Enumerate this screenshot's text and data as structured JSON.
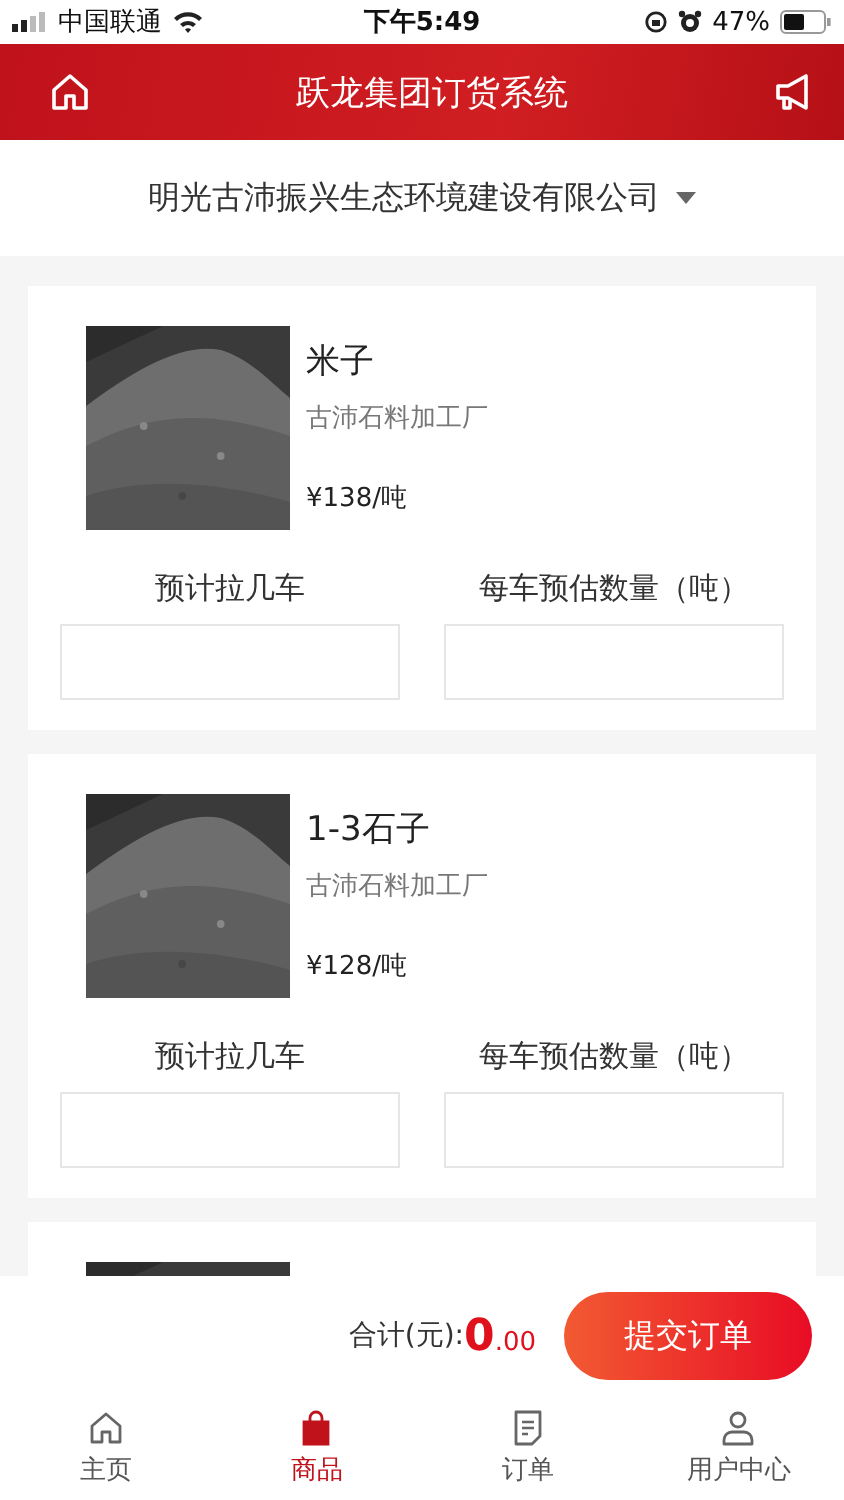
{
  "status_bar": {
    "carrier": "中国联通",
    "time": "下午5:49",
    "battery": "47%"
  },
  "header": {
    "title": "跃龙集团订货系统"
  },
  "company": {
    "name": "明光古沛振兴生态环境建设有限公司"
  },
  "products": [
    {
      "image": {
        "kind": "picture"
      },
      "name": "米子",
      "supplier": "古沛石料加工厂",
      "price": "¥138/吨",
      "fields": [
        {
          "label": "预计拉几车"
        },
        {
          "label": "每车预估数量（吨）"
        }
      ]
    },
    {
      "image": {
        "kind": "picture"
      },
      "name": "1-3石子",
      "supplier": "古沛石料加工厂",
      "price": "¥128/吨",
      "fields": [
        {
          "label": "预计拉几车"
        },
        {
          "label": "每车预估数量（吨）"
        }
      ]
    },
    {
      "image": {
        "kind": "picture"
      }
    }
  ],
  "footer": {
    "total_label": "合计(元):",
    "total_int": "0",
    "total_dec": ".00",
    "submit": "提交订单"
  },
  "tabs": [
    {
      "kind": "home",
      "label": "主页",
      "selected": false
    },
    {
      "kind": "goods",
      "label": "商品",
      "selected": true
    },
    {
      "kind": "orders",
      "label": "订单",
      "selected": false
    },
    {
      "kind": "user",
      "label": "用户中心",
      "selected": false
    }
  ]
}
